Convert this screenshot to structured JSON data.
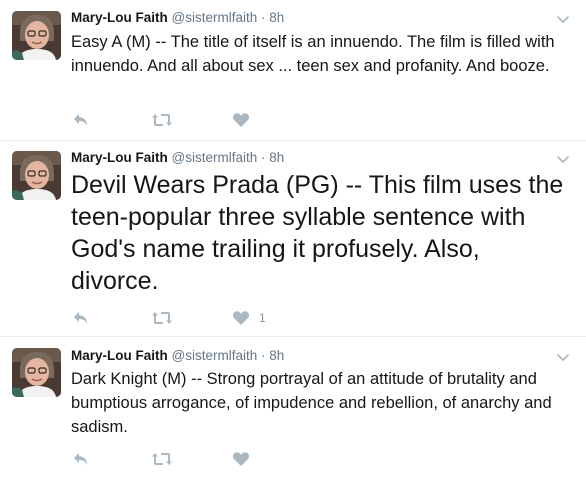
{
  "tweets": [
    {
      "name": "Mary-Lou Faith",
      "handle": "@sistermlfaith",
      "dot": "·",
      "time": "8h",
      "text": "Easy A (M) -- The title of itself is an innuendo. The film is filled with innuendo. And all about sex ... teen sex and profanity. And booze.",
      "like_count": ""
    },
    {
      "name": "Mary-Lou Faith",
      "handle": "@sistermlfaith",
      "dot": "·",
      "time": "8h",
      "text": "Devil Wears Prada (PG) -- This film uses the teen-popular three syllable sentence with God's name trailing it profusely. Also, divorce.",
      "like_count": "1"
    },
    {
      "name": "Mary-Lou Faith",
      "handle": "@sistermlfaith",
      "dot": "·",
      "time": "8h",
      "text": "Dark Knight (M) -- Strong portrayal of an attitude of brutality and bumptious arrogance, of impudence and rebellion, of anarchy and sadism.",
      "like_count": ""
    }
  ],
  "icons": {
    "reply": "reply-icon",
    "retweet": "retweet-icon",
    "like": "heart-icon",
    "caret": "chevron-down-icon"
  },
  "colors": {
    "icon": "#aab8c2",
    "border": "#e6ecf0",
    "secondary_text": "#657786"
  }
}
